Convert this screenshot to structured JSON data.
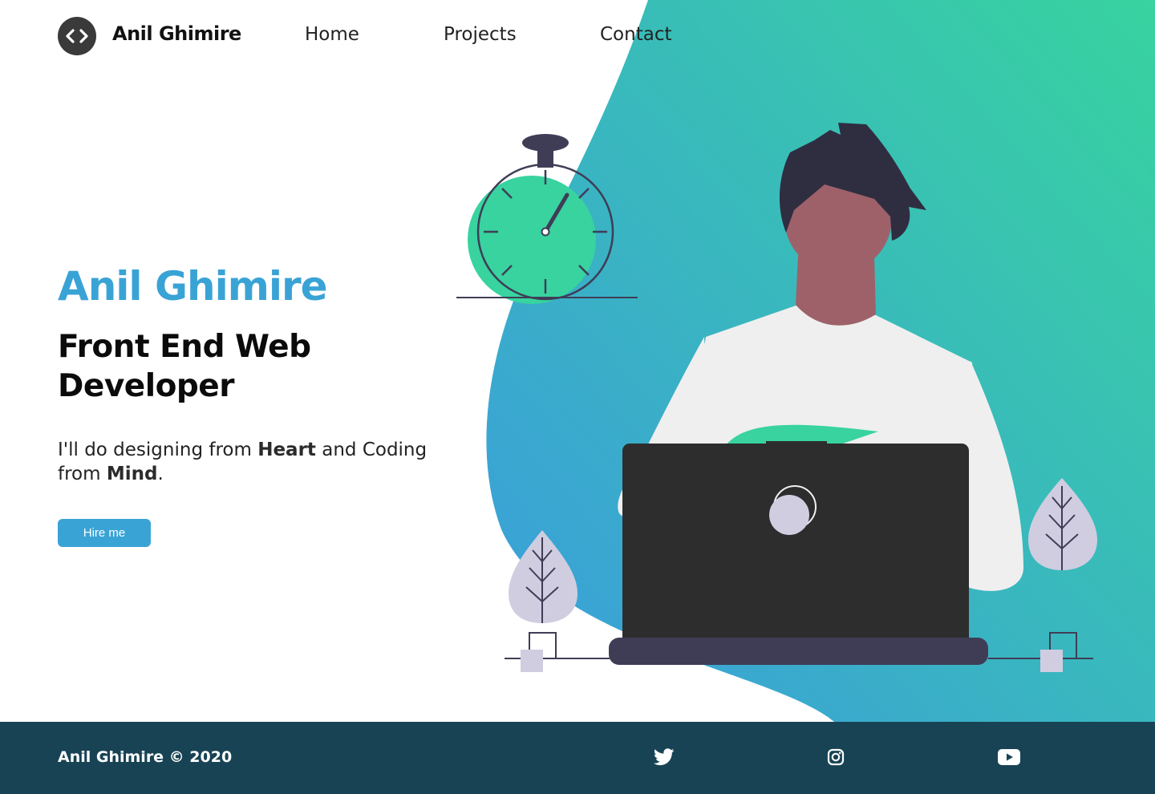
{
  "header": {
    "brand_name": "Anil Ghimire",
    "logo_glyph": "<>",
    "logo_icon": "code-icon",
    "nav": [
      {
        "label": "Home"
      },
      {
        "label": "Projects"
      },
      {
        "label": "Contact"
      }
    ]
  },
  "hero": {
    "name": "Anil Ghimire",
    "role": "Front End Web Developer",
    "tagline": {
      "part1": "I'll do designing from ",
      "bold1": "Heart",
      "part2": " and Coding from ",
      "bold2": "Mind",
      "part3": "."
    },
    "hire_button": "Hire me"
  },
  "footer": {
    "copyright": "Anil Ghimire © 2020",
    "social_icons": [
      "twitter-icon",
      "instagram-icon",
      "youtube-icon"
    ]
  },
  "colors": {
    "accent_blue": "#3aa3d5",
    "accent_green": "#38d39f",
    "footer_bg": "#184354",
    "logo_bg": "#3a3a3a",
    "laptop": "#2d2d2d",
    "laptop_base": "#3f3d56",
    "skin": "#9e616a",
    "hair": "#2f2e41",
    "leaf": "#d0cde1"
  }
}
